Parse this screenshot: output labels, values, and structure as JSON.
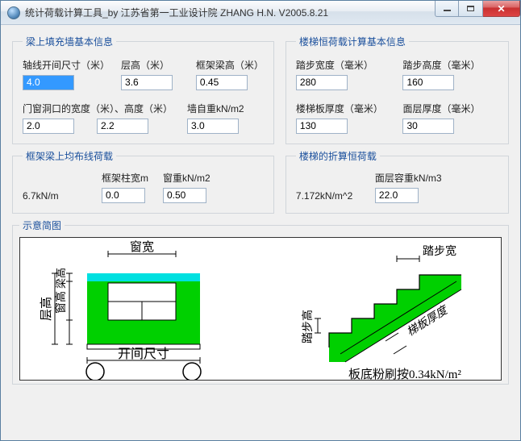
{
  "window": {
    "title": "统计荷载计算工具_by 江苏省第一工业设计院 ZHANG H.N.      V2005.8.21"
  },
  "groups": {
    "wall": {
      "legend": "梁上填充墙基本信息",
      "axis_span_label": "轴线开间尺寸（米）",
      "axis_span_value": "4.0",
      "floor_h_label": "层高（米）",
      "floor_h_value": "3.6",
      "beam_h_label": "框架梁高（米）",
      "beam_h_value": "0.45",
      "opening_w_label": "门窗洞口的宽度（米）、高度（米）",
      "opening_w_value": "2.0",
      "opening_h_value": "2.2",
      "wall_weight_label": "墙自重kN/m2",
      "wall_weight_value": "3.0"
    },
    "stair": {
      "legend": "楼梯恒荷载计算基本信息",
      "tread_w_label": "踏步宽度（毫米）",
      "tread_w_value": "280",
      "tread_h_label": "踏步高度（毫米）",
      "tread_h_value": "160",
      "slab_t_label": "楼梯板厚度（毫米）",
      "slab_t_value": "130",
      "finish_t_label": "面层厚度（毫米）",
      "finish_t_value": "30"
    },
    "beam_load": {
      "legend": "框架梁上均布线荷载",
      "result": "6.7kN/m",
      "col_w_label": "框架柱宽m",
      "col_w_value": "0.0",
      "window_load_label": "窗重kN/m2",
      "window_load_value": "0.50"
    },
    "stair_load": {
      "legend": "楼梯的折算恒荷载",
      "result": "7.172kN/m^2",
      "finish_density_label": "面层容重kN/m3",
      "finish_density_value": "22.0"
    },
    "diagram": {
      "legend": "示意简图",
      "window_w": "窗宽",
      "window_h": "窗高",
      "beam_h": "梁高",
      "floor_h": "层高",
      "span": "开间尺寸",
      "tread_w": "踏步宽",
      "tread_h": "踏步高",
      "slab_t": "梯板厚度",
      "plaster_note": "板底粉刷按0.34kN/m²"
    }
  }
}
